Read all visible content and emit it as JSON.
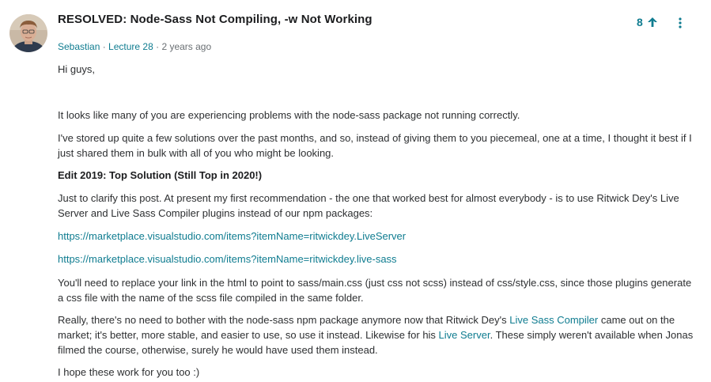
{
  "post": {
    "title": "RESOLVED: Node-Sass Not Compiling, -w Not Working",
    "author": "Sebastian",
    "separator1": " · ",
    "lecture": "Lecture 28",
    "separator2": " · ",
    "time_ago": "2 years ago",
    "upvotes": "8"
  },
  "body": {
    "greeting": "Hi guys,",
    "p1": "It looks like many of you are experiencing problems with the node-sass package not running correctly.",
    "p2": "I've stored up quite a few solutions over the past months, and so, instead of giving them to you piecemeal, one at a time, I thought it best if I just shared them in bulk with all of you who might be looking.",
    "heading": "Edit 2019: Top Solution (Still Top in 2020!)",
    "p4": "Just to clarify this post. At present my first recommendation - the one that worked best for almost everybody - is to use Ritwick Dey's Live Server and Live Sass Compiler plugins instead of our npm packages:",
    "link1": "https://marketplace.visualstudio.com/items?itemName=ritwickdey.LiveServer",
    "link2": "https://marketplace.visualstudio.com/items?itemName=ritwickdey.live-sass",
    "p7": "You'll need to replace your link in the html to point to sass/main.css (just css not scss) instead of css/style.css, since those plugins generate a css file with the name of the scss file compiled in the same folder.",
    "p8_a": "Really, there's no need to bother with the node-sass npm package anymore now that Ritwick Dey's ",
    "p8_link1": "Live Sass Compiler",
    "p8_b": " came out on the market; it's better, more stable, and easier to use, so use it instead. Likewise for his ",
    "p8_link2": "Live Server",
    "p8_c": ". These simply weren't available when Jonas filmed the course, otherwise, surely he would have used them instead.",
    "p9": "I hope these work for you too :)"
  },
  "icons": {
    "upvote": "arrow-up-icon",
    "menu": "more-vertical-icon",
    "avatar": "user-avatar"
  },
  "colors": {
    "accent": "#0f7c90",
    "text": "#2d2f31",
    "muted": "#6a6f73"
  }
}
